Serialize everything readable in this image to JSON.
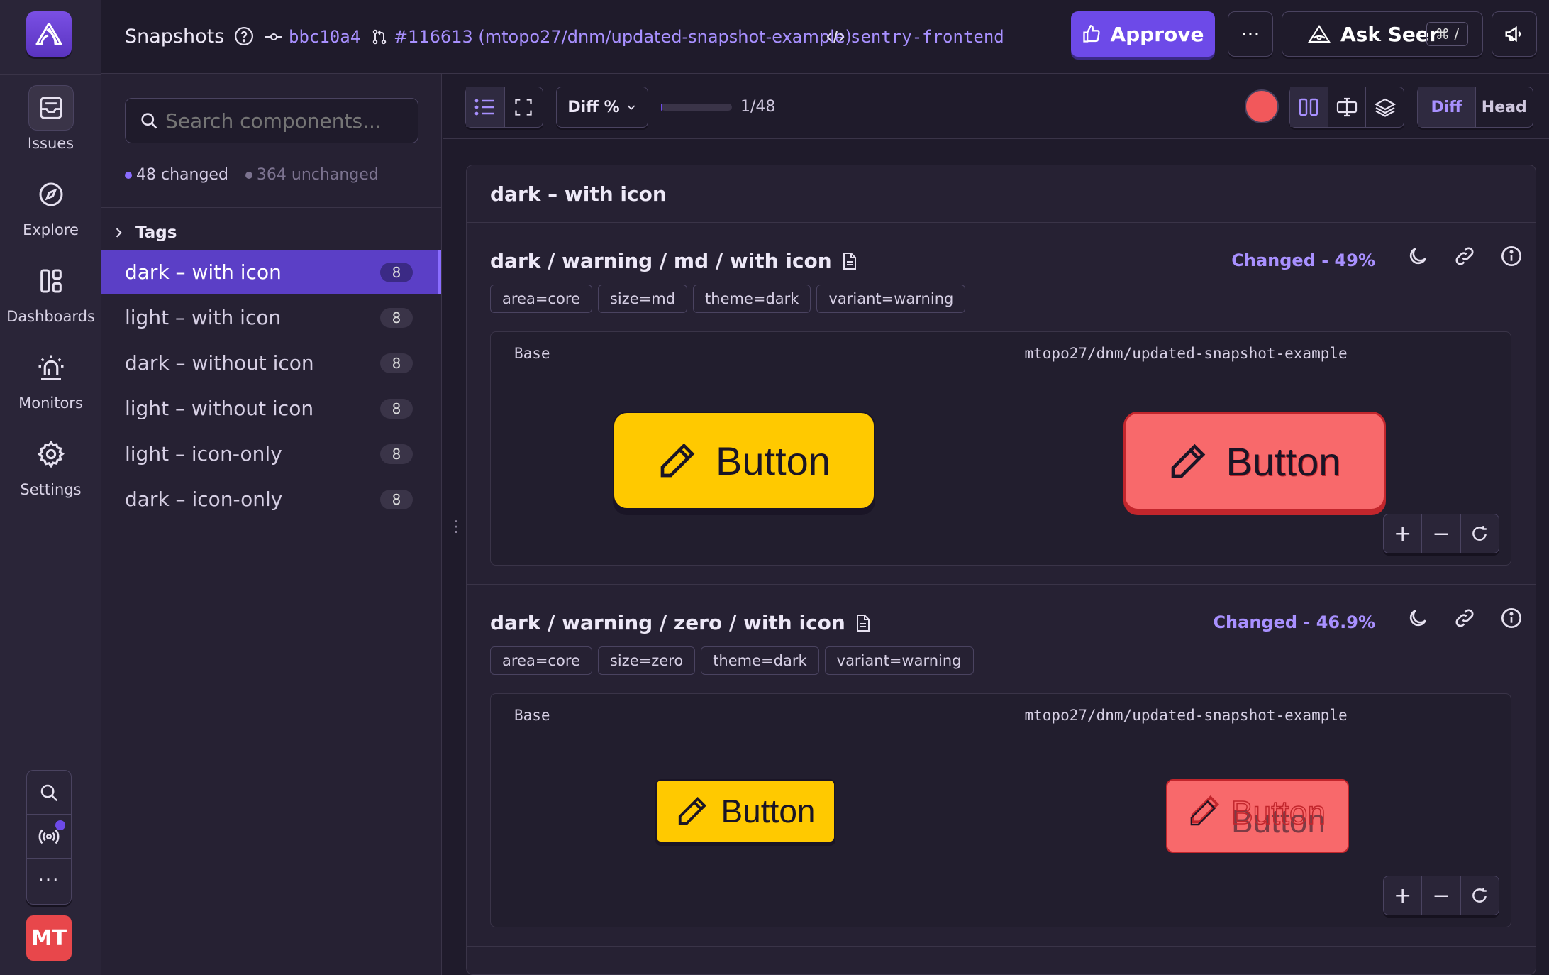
{
  "rail": {
    "items": [
      {
        "label": "Issues",
        "icon": "inbox-icon"
      },
      {
        "label": "Explore",
        "icon": "compass-icon"
      },
      {
        "label": "Dashboards",
        "icon": "dashboard-icon"
      },
      {
        "label": "Monitors",
        "icon": "siren-icon"
      },
      {
        "label": "Settings",
        "icon": "gear-icon"
      }
    ],
    "avatar": "MT"
  },
  "header": {
    "title": "Snapshots",
    "commit": "bbc10a4",
    "pr": "#116613 (mtopo27/dnm/updated-snapshot-example)",
    "repo": "sentry-frontend",
    "approve_label": "Approve",
    "more_label": "···",
    "seer_label": "Ask Seer",
    "seer_shortcut": "⌘ /"
  },
  "sidebar": {
    "search_placeholder": "Search components...",
    "changed_count": "48 changed",
    "unchanged_count": "364 unchanged",
    "tags_label": "Tags",
    "groups": [
      {
        "label": "dark – with icon",
        "count": "8",
        "active": true
      },
      {
        "label": "light – with icon",
        "count": "8"
      },
      {
        "label": "dark – without icon",
        "count": "8"
      },
      {
        "label": "light – without icon",
        "count": "8"
      },
      {
        "label": "light – icon-only",
        "count": "8"
      },
      {
        "label": "dark – icon-only",
        "count": "8"
      }
    ]
  },
  "toolbar": {
    "diff_select": "Diff %",
    "progress": 0.02,
    "page_count": "1/48",
    "diff_label": "Diff",
    "head_label": "Head"
  },
  "main": {
    "group_title": "dark – with icon",
    "snapshots": [
      {
        "title": "dark / warning / md / with icon",
        "status": "Changed - 49%",
        "tags": [
          "area=core",
          "size=md",
          "theme=dark",
          "variant=warning"
        ],
        "base_label": "Base",
        "head_label": "mtopo27/dnm/updated-snapshot-example",
        "button_text": "Button"
      },
      {
        "title": "dark / warning / zero / with icon",
        "status": "Changed - 46.9%",
        "tags": [
          "area=core",
          "size=zero",
          "theme=dark",
          "variant=warning"
        ],
        "base_label": "Base",
        "head_label": "mtopo27/dnm/updated-snapshot-example",
        "button_text": "Button"
      }
    ]
  },
  "colors": {
    "accent": "#6d4ae8",
    "accent_text": "#a890ff",
    "warning_yellow": "#ffc900",
    "diff_red": "#f8696b"
  }
}
